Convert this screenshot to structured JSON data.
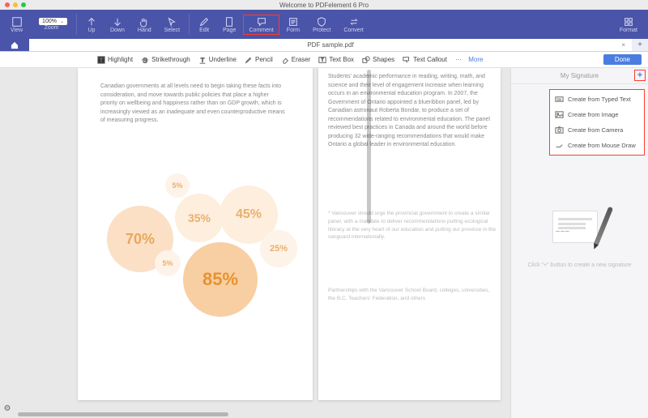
{
  "window": {
    "title": "Welcome to PDFelement 6 Pro"
  },
  "ribbon": {
    "view": "View",
    "zoom": "Zoom",
    "zoom_value": "100%",
    "up": "Up",
    "down": "Down",
    "hand": "Hand",
    "select": "Select",
    "edit": "Edit",
    "page": "Page",
    "comment": "Comment",
    "form": "Form",
    "protect": "Protect",
    "convert": "Convert",
    "format": "Format"
  },
  "tab": {
    "filename": "PDF sample.pdf"
  },
  "toolbar": {
    "highlight": "Highlight",
    "strike": "Strikethrough",
    "underline": "Underline",
    "pencil": "Pencil",
    "eraser": "Eraser",
    "textbox": "Text Box",
    "shapes": "Shapes",
    "callout": "Text Callout",
    "more": "More",
    "done": "Done"
  },
  "document": {
    "left_paragraph": "Canadian governments at all levels need to begin taking these facts into consideration, and move towards public policies that place a higher priority on wellbeing and happiness rather than on GDP growth, which is increasingly viewed as an inadequate and even counterproductive means of measuring progress.",
    "right_p1": "Students' academic performance in reading, writing, math, and science and their level of engagement increase when learning occurs in an environmental education program. In 2007, the Government of Ontario appointed a blueribbon panel, led by Canadian astronaut Roberta Bondar, to produce a set of recommendations related to environmental education. The panel reviewed best practices in Canada and around the world before producing 32 wide-ranging recommendations that would make Ontario a global leader in environmental education.",
    "right_p2": "* Vancouver should urge the provincial government to create a similar panel, with a mandate to deliver recommendations putting ecological literacy at the very heart of our education and putting our province in the vanguard internationally.",
    "right_p3": "Partnerships with the Vancouver School Board, colleges, universities, the B.C. Teachers' Federation, and others"
  },
  "chart_data": {
    "type": "bubble",
    "title": "",
    "series": [
      {
        "label": "70%",
        "value": 70
      },
      {
        "label": "35%",
        "value": 35
      },
      {
        "label": "45%",
        "value": 45
      },
      {
        "label": "85%",
        "value": 85
      },
      {
        "label": "25%",
        "value": 25
      },
      {
        "label": "5%",
        "value": 5
      },
      {
        "label": "5%",
        "value": 5
      }
    ]
  },
  "panel": {
    "title": "My Signature",
    "hint": "Click \"+\" button to create a new signature",
    "menu": {
      "typed": "Create from Typed Text",
      "image": "Create from Image",
      "camera": "Create from Camera",
      "draw": "Create from Mouse Draw"
    }
  }
}
